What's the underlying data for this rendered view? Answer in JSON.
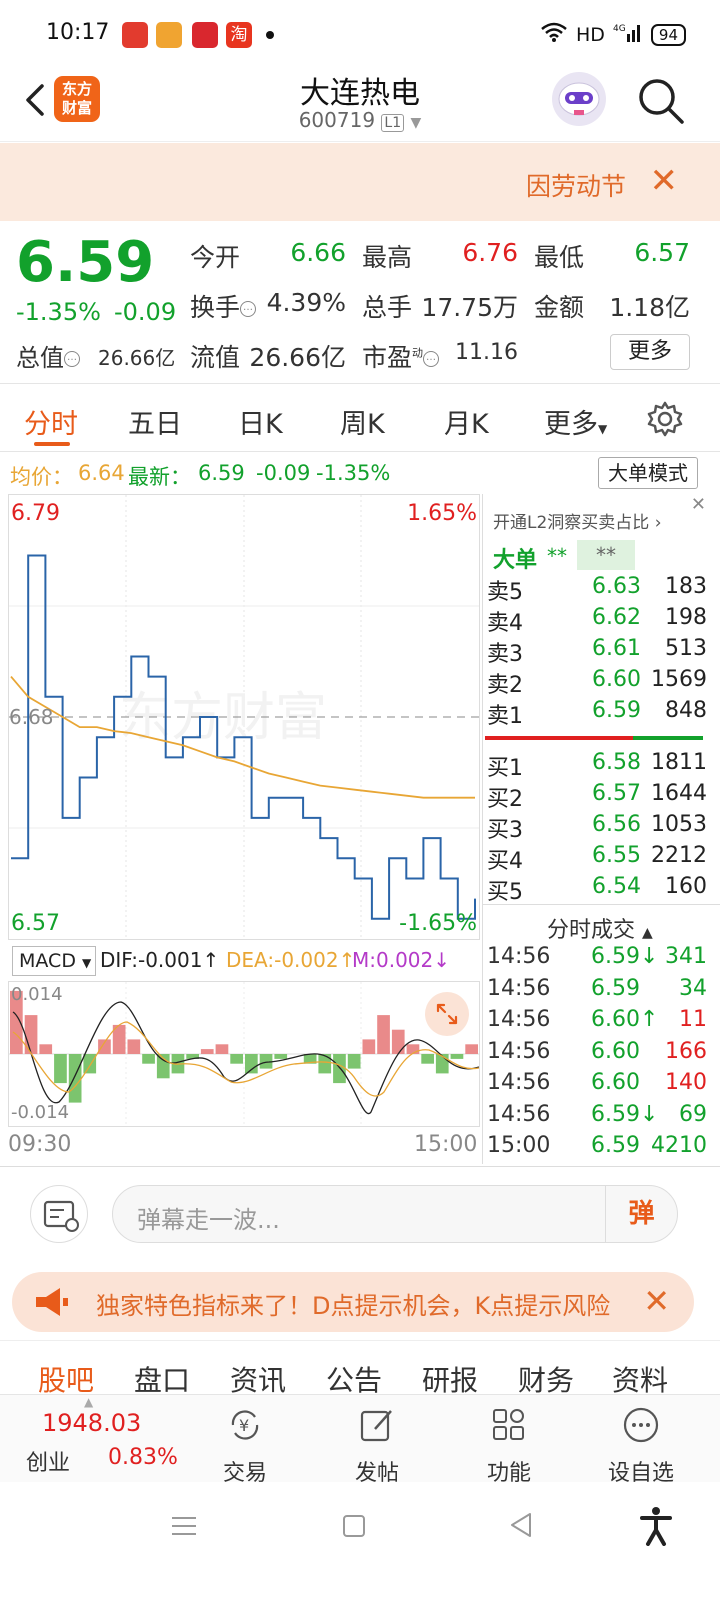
{
  "status": {
    "time": "10:17",
    "network": "HD",
    "signal": "4G",
    "battery": "94"
  },
  "header": {
    "logo_line1": "东方",
    "logo_line2": "财富",
    "title": "大连热电",
    "code": "600719",
    "level": "L1"
  },
  "banner": {
    "text": "因劳动节",
    "close": "✕"
  },
  "quote": {
    "price": "6.59",
    "pct": "-1.35%",
    "change": "-0.09",
    "open_label": "今开",
    "open": "6.66",
    "high_label": "最高",
    "high": "6.76",
    "low_label": "最低",
    "low": "6.57",
    "turnover_label": "换手",
    "turnover": "4.39%",
    "volume_label": "总手",
    "volume": "17.75万",
    "amount_label": "金额",
    "amount": "1.18亿",
    "mktcap_label": "总值",
    "mktcap": "26.66亿",
    "float_label": "流值",
    "float": "26.66亿",
    "pe_label": "市盈",
    "pe_sup": "动",
    "pe": "11.16",
    "more": "更多"
  },
  "tabs": [
    "分时",
    "五日",
    "日K",
    "周K",
    "月K",
    "更多"
  ],
  "avg": {
    "label": "均价：",
    "avg": "6.64",
    "latest_label": "最新：",
    "latest": "6.59",
    "change": "-0.09",
    "pct": "-1.35%",
    "mode": "大单模式"
  },
  "chart": {
    "top_price": "6.79",
    "top_pct": "1.65%",
    "mid_price": "6.68",
    "bottom_price": "6.57",
    "bottom_pct": "-1.65%",
    "watermark": "东方财富",
    "start": "09:30",
    "end": "15:00"
  },
  "macd": {
    "select": "MACD",
    "dif": "DIF:-0.001↑",
    "dea": "DEA:-0.002↑",
    "m": "M:0.002↓",
    "top": "0.014",
    "bottom": "-0.014"
  },
  "chart_data": [
    {
      "type": "line",
      "title": "",
      "xlabel": "",
      "ylabel": "",
      "x": [
        "09:30",
        "15:00"
      ],
      "ylim": [
        6.57,
        6.79
      ],
      "reference": 6.68,
      "series": [
        {
          "name": "",
          "values": [
            6.61,
            6.76,
            6.69,
            6.63,
            6.65,
            6.67,
            6.69,
            6.71,
            6.7,
            6.66,
            6.67,
            6.68,
            6.66,
            6.67,
            6.63,
            6.64,
            6.64,
            6.63,
            6.62,
            6.61,
            6.6,
            6.58,
            6.61,
            6.6,
            6.62,
            6.6,
            6.58,
            6.59
          ]
        },
        {
          "name": "",
          "values": [
            6.7,
            6.69,
            6.685,
            6.68,
            6.675,
            6.675,
            6.673,
            6.672,
            6.67,
            6.668,
            6.666,
            6.663,
            6.66,
            6.658,
            6.655,
            6.652,
            6.65,
            6.648,
            6.646,
            6.645,
            6.644,
            6.643,
            6.642,
            6.641,
            6.64,
            6.64,
            6.64,
            6.64
          ]
        }
      ]
    },
    {
      "type": "bar",
      "title": "MACD",
      "ylim": [
        -0.014,
        0.014
      ],
      "values": [
        0.013,
        0.008,
        0.002,
        -0.006,
        -0.01,
        -0.004,
        0.003,
        0.006,
        0.003,
        -0.002,
        -0.005,
        -0.004,
        -0.001,
        0.001,
        0.002,
        -0.002,
        -0.004,
        -0.003,
        -0.001,
        0.0,
        -0.002,
        -0.004,
        -0.006,
        -0.003,
        0.003,
        0.008,
        0.005,
        0.002,
        -0.002,
        -0.004,
        -0.001,
        0.002
      ]
    }
  ],
  "orderbook": {
    "header": "开通L2洞察买卖占比",
    "big_label": "大单",
    "big_v1": "**",
    "big_v2": "**",
    "asks": [
      {
        "name": "卖5",
        "price": "6.63",
        "vol": "183"
      },
      {
        "name": "卖4",
        "price": "6.62",
        "vol": "198"
      },
      {
        "name": "卖3",
        "price": "6.61",
        "vol": "513"
      },
      {
        "name": "卖2",
        "price": "6.60",
        "vol": "1569"
      },
      {
        "name": "卖1",
        "price": "6.59",
        "vol": "848"
      }
    ],
    "bids": [
      {
        "name": "买1",
        "price": "6.58",
        "vol": "1811"
      },
      {
        "name": "买2",
        "price": "6.57",
        "vol": "1644"
      },
      {
        "name": "买3",
        "price": "6.56",
        "vol": "1053"
      },
      {
        "name": "买4",
        "price": "6.55",
        "vol": "2212"
      },
      {
        "name": "买5",
        "price": "6.54",
        "vol": "160"
      }
    ],
    "trades_title": "分时成交",
    "trades": [
      {
        "time": "14:56",
        "price": "6.59↓",
        "vol": "341",
        "color": "#12a12c"
      },
      {
        "time": "14:56",
        "price": "6.59",
        "vol": "34",
        "color": "#12a12c"
      },
      {
        "time": "14:56",
        "price": "6.60↑",
        "vol": "11",
        "color": "#e02020"
      },
      {
        "time": "14:56",
        "price": "6.60",
        "vol": "166",
        "color": "#e02020"
      },
      {
        "time": "14:56",
        "price": "6.60",
        "vol": "140",
        "color": "#e02020"
      },
      {
        "time": "14:56",
        "price": "6.59↓",
        "vol": "69",
        "color": "#12a12c"
      },
      {
        "time": "15:00",
        "price": "6.59",
        "vol": "4210",
        "color": "#12a12c"
      }
    ]
  },
  "comment": {
    "placeholder": "弹幕走一波...",
    "danmu": "弹"
  },
  "promo": {
    "text": "独家特色指标来了！D点提示机会，K点提示风险",
    "close": "✕"
  },
  "subtabs": [
    "股吧",
    "盘口",
    "资讯",
    "公告",
    "研报",
    "财务",
    "资料"
  ],
  "bottom": {
    "index_value": "1948.03",
    "index_name": "创业",
    "index_pct": "0.83%",
    "items": [
      "交易",
      "发帖",
      "功能",
      "设自选"
    ]
  },
  "colors": {
    "up": "#e02020",
    "down": "#12a12c",
    "accent": "#e85b1a",
    "price_line": "#2a64a8",
    "avg_line": "#e8a635"
  }
}
